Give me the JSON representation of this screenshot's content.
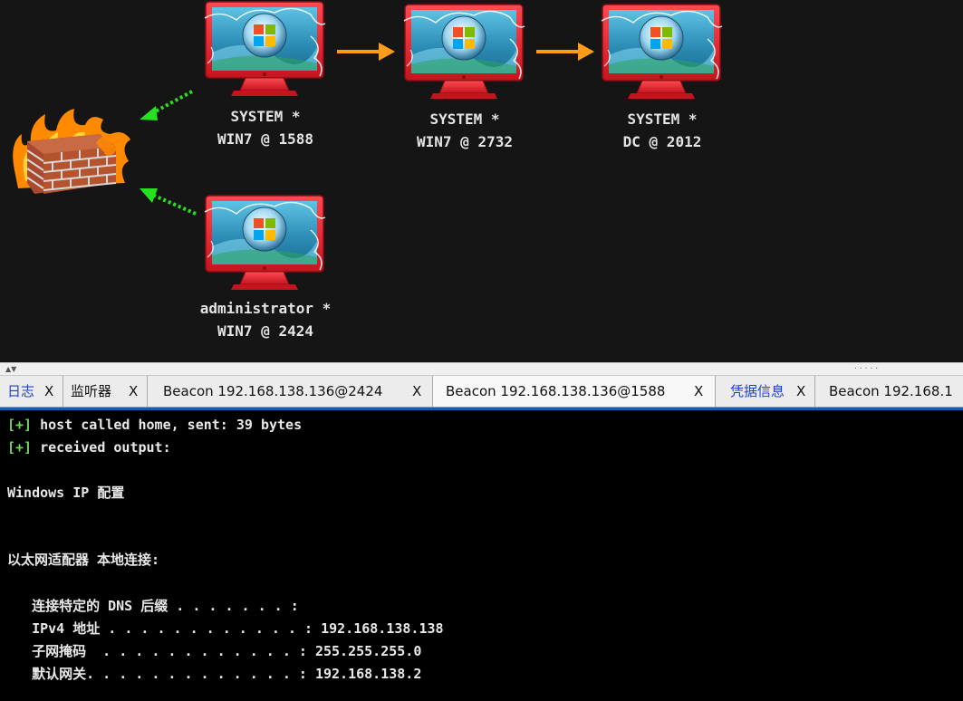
{
  "graph": {
    "nodes": [
      {
        "user": "SYSTEM *",
        "host": "WIN7 @ 1588"
      },
      {
        "user": "SYSTEM *",
        "host": "WIN7 @ 2732"
      },
      {
        "user": "SYSTEM *",
        "host": "DC @ 2012"
      },
      {
        "user": "administrator *",
        "host": "WIN7 @ 2424"
      }
    ],
    "colors": {
      "link_arrow": "#ff9c1a",
      "egress_arrow": "#27e01f",
      "monitor_frame": "#e31f2b",
      "screen": "#2e8fb8",
      "background": "#151515"
    }
  },
  "tabs": [
    {
      "label": "日志",
      "close": "X"
    },
    {
      "label": "监听器",
      "close": "X"
    },
    {
      "label": "Beacon 192.168.138.136@2424",
      "close": "X"
    },
    {
      "label": "Beacon 192.168.138.136@1588",
      "close": "X"
    },
    {
      "label": "凭据信息",
      "close": "X"
    },
    {
      "label": "Beacon 192.168.1",
      "close": ""
    }
  ],
  "console": {
    "lines": [
      {
        "prefix": "[+]",
        "text": " host called home, sent: 39 bytes"
      },
      {
        "prefix": "[+]",
        "text": " received output:"
      },
      {
        "prefix": "",
        "text": "Windows IP 配置"
      },
      {
        "prefix": "",
        "text": "以太网适配器 本地连接:"
      },
      {
        "prefix": "",
        "text": "   连接特定的 DNS 后缀 . . . . . . . :"
      },
      {
        "prefix": "",
        "text": "   IPv4 地址 . . . . . . . . . . . . : 192.168.138.138"
      },
      {
        "prefix": "",
        "text": "   子网掩码  . . . . . . . . . . . . : 255.255.255.0"
      },
      {
        "prefix": "",
        "text": "   默认网关. . . . . . . . . . . . . : 192.168.138.2"
      }
    ]
  }
}
